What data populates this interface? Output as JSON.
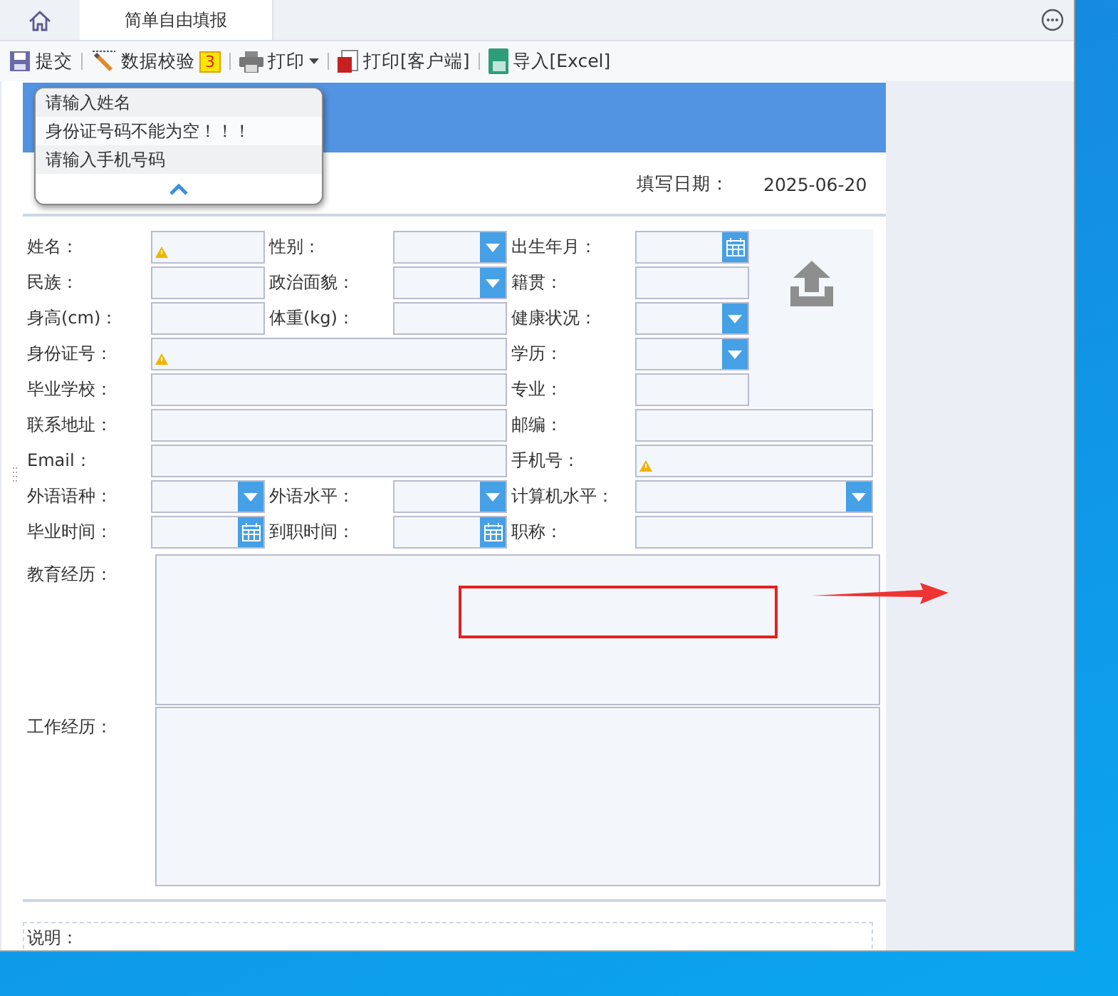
{
  "tabs": [
    {
      "kind": "home",
      "selected": false
    },
    {
      "kind": "text",
      "label": "简单自由填报",
      "selected": true
    }
  ],
  "toolbar": [
    {
      "kind": "save",
      "label": "提交",
      "dropdown": false
    },
    {
      "kind": "check",
      "label": "数据校验",
      "badge": "3",
      "dropdown": false
    },
    {
      "kind": "print",
      "label": "打印",
      "dropdown": true
    },
    {
      "kind": "pdf",
      "label": "打印[客户端]",
      "dropdown": false
    },
    {
      "kind": "excel",
      "label": "导入[Excel]",
      "dropdown": false
    }
  ],
  "validation_popup": {
    "messages": [
      "请输入姓名",
      "身份证号码不能为空！！！",
      "请输入手机号码"
    ]
  },
  "form": {
    "date_label": "填写日期：",
    "date_value": "2025-06-20",
    "rows": [
      [
        {
          "label": "姓名：",
          "kind": "text",
          "warning": true
        },
        {
          "label": "性别：",
          "kind": "select",
          "warning": false
        },
        {
          "label": "出生年月：",
          "kind": "date",
          "warning": false
        }
      ],
      [
        {
          "label": "民族：",
          "kind": "text",
          "warning": false
        },
        {
          "label": "政治面貌：",
          "kind": "select",
          "warning": false
        },
        {
          "label": "籍贯：",
          "kind": "text",
          "warning": false
        }
      ],
      [
        {
          "label": "身高(cm)：",
          "kind": "text",
          "warning": false
        },
        {
          "label": "体重(kg)：",
          "kind": "text",
          "warning": false
        },
        {
          "label": "健康状况：",
          "kind": "select",
          "warning": false
        }
      ],
      [
        {
          "label": "身份证号：",
          "kind": "text",
          "warning": true
        },
        {
          "label": "学历：",
          "kind": "select",
          "warning": false
        }
      ],
      [
        {
          "label": "毕业学校：",
          "kind": "text",
          "warning": false
        },
        {
          "label": "专业：",
          "kind": "text",
          "warning": false
        }
      ],
      [
        {
          "label": "联系地址：",
          "kind": "text",
          "warning": false
        },
        {
          "label": "邮编：",
          "kind": "text",
          "warning": false
        }
      ],
      [
        {
          "label": "Email：",
          "kind": "text",
          "warning": false
        },
        {
          "label": "手机号：",
          "kind": "text",
          "warning": true
        }
      ],
      [
        {
          "label": "外语语种：",
          "kind": "select",
          "warning": false
        },
        {
          "label": "外语水平：",
          "kind": "select",
          "warning": false
        },
        {
          "label": "计算机水平：",
          "kind": "select",
          "warning": false
        }
      ],
      [
        {
          "label": "毕业时间：",
          "kind": "date",
          "warning": false
        },
        {
          "label": "到职时间：",
          "kind": "date",
          "warning": false
        },
        {
          "label": "职称：",
          "kind": "text",
          "warning": false
        }
      ]
    ],
    "text_areas": [
      {
        "label": "教育经历："
      },
      {
        "label": "工作经历："
      }
    ],
    "note_label": "说明："
  }
}
